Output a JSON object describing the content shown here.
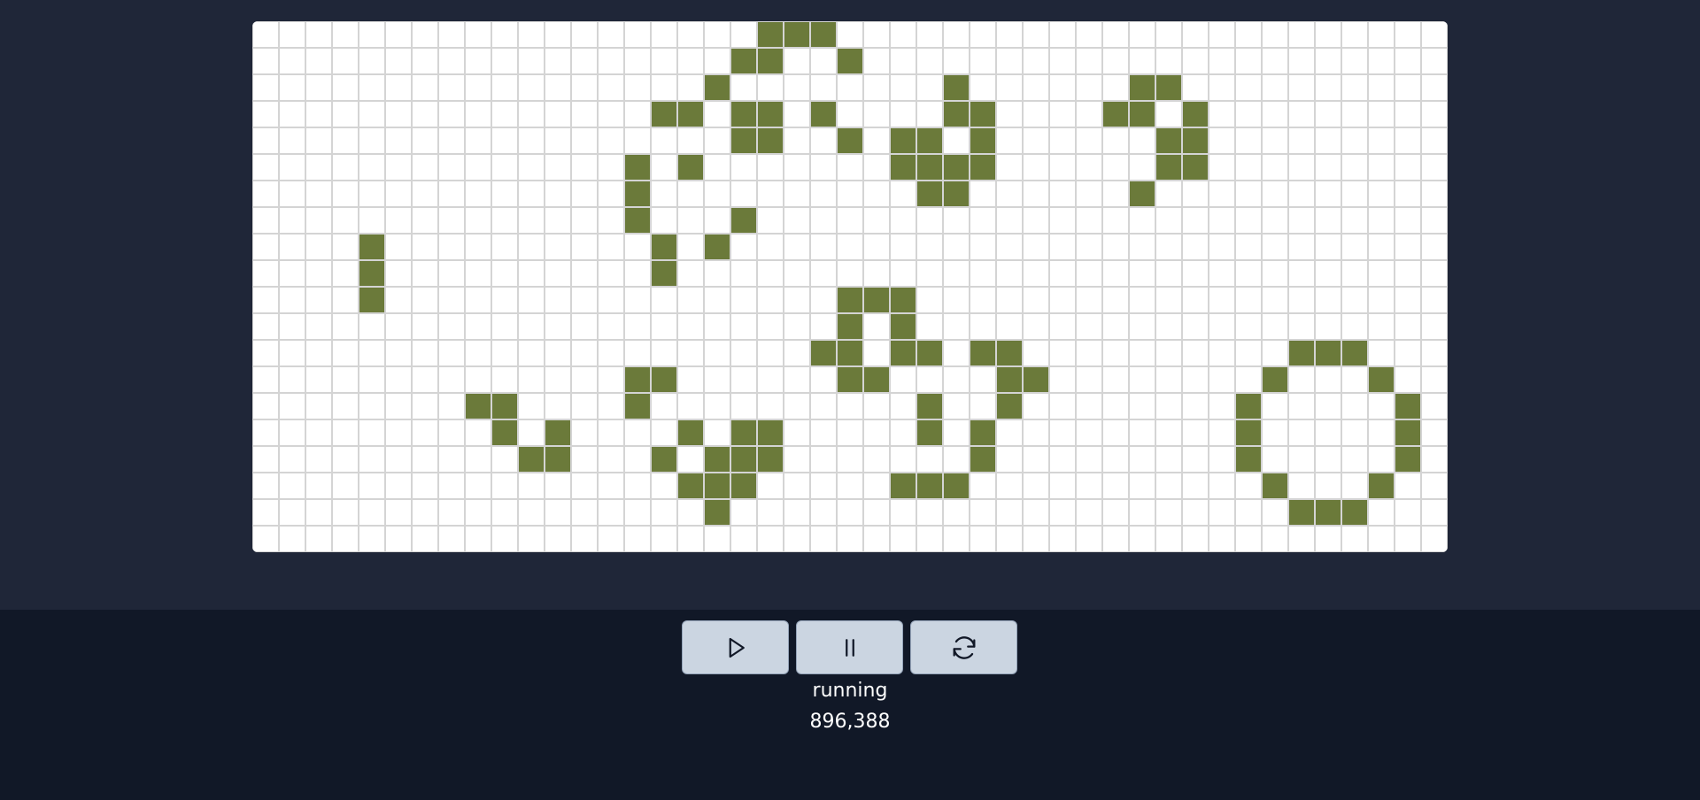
{
  "game": {
    "status": "running",
    "generation": "896,388",
    "cell_color": "#6b7a3a",
    "grid_line_color": "#d4d4d4",
    "grid": {
      "cols": 45,
      "rows": 20,
      "live_cells": [
        [
          19,
          0
        ],
        [
          20,
          0
        ],
        [
          21,
          0
        ],
        [
          18,
          1
        ],
        [
          19,
          1
        ],
        [
          22,
          1
        ],
        [
          17,
          2
        ],
        [
          26,
          2
        ],
        [
          33,
          2
        ],
        [
          34,
          2
        ],
        [
          15,
          3
        ],
        [
          16,
          3
        ],
        [
          18,
          3
        ],
        [
          19,
          3
        ],
        [
          21,
          3
        ],
        [
          26,
          3
        ],
        [
          27,
          3
        ],
        [
          32,
          3
        ],
        [
          33,
          3
        ],
        [
          35,
          3
        ],
        [
          18,
          4
        ],
        [
          19,
          4
        ],
        [
          22,
          4
        ],
        [
          24,
          4
        ],
        [
          25,
          4
        ],
        [
          27,
          4
        ],
        [
          34,
          4
        ],
        [
          35,
          4
        ],
        [
          14,
          5
        ],
        [
          16,
          5
        ],
        [
          24,
          5
        ],
        [
          25,
          5
        ],
        [
          26,
          5
        ],
        [
          27,
          5
        ],
        [
          34,
          5
        ],
        [
          35,
          5
        ],
        [
          14,
          6
        ],
        [
          25,
          6
        ],
        [
          26,
          6
        ],
        [
          33,
          6
        ],
        [
          14,
          7
        ],
        [
          18,
          7
        ],
        [
          4,
          8
        ],
        [
          15,
          8
        ],
        [
          17,
          8
        ],
        [
          4,
          9
        ],
        [
          15,
          9
        ],
        [
          4,
          10
        ],
        [
          22,
          10
        ],
        [
          23,
          10
        ],
        [
          24,
          10
        ],
        [
          22,
          11
        ],
        [
          24,
          11
        ],
        [
          21,
          12
        ],
        [
          22,
          12
        ],
        [
          24,
          12
        ],
        [
          25,
          12
        ],
        [
          27,
          12
        ],
        [
          28,
          12
        ],
        [
          39,
          12
        ],
        [
          40,
          12
        ],
        [
          41,
          12
        ],
        [
          14,
          13
        ],
        [
          15,
          13
        ],
        [
          22,
          13
        ],
        [
          23,
          13
        ],
        [
          28,
          13
        ],
        [
          29,
          13
        ],
        [
          38,
          13
        ],
        [
          42,
          13
        ],
        [
          8,
          14
        ],
        [
          9,
          14
        ],
        [
          14,
          14
        ],
        [
          25,
          14
        ],
        [
          28,
          14
        ],
        [
          37,
          14
        ],
        [
          43,
          14
        ],
        [
          9,
          15
        ],
        [
          11,
          15
        ],
        [
          16,
          15
        ],
        [
          18,
          15
        ],
        [
          19,
          15
        ],
        [
          25,
          15
        ],
        [
          27,
          15
        ],
        [
          37,
          15
        ],
        [
          43,
          15
        ],
        [
          10,
          16
        ],
        [
          11,
          16
        ],
        [
          15,
          16
        ],
        [
          17,
          16
        ],
        [
          18,
          16
        ],
        [
          19,
          16
        ],
        [
          27,
          16
        ],
        [
          37,
          16
        ],
        [
          43,
          16
        ],
        [
          16,
          17
        ],
        [
          17,
          17
        ],
        [
          18,
          17
        ],
        [
          24,
          17
        ],
        [
          25,
          17
        ],
        [
          26,
          17
        ],
        [
          38,
          17
        ],
        [
          42,
          17
        ],
        [
          17,
          18
        ],
        [
          39,
          18
        ],
        [
          40,
          18
        ],
        [
          41,
          18
        ]
      ]
    }
  },
  "controls": {
    "play": {
      "icon": "play-icon"
    },
    "pause": {
      "icon": "pause-icon"
    },
    "reset": {
      "icon": "refresh-icon"
    }
  }
}
